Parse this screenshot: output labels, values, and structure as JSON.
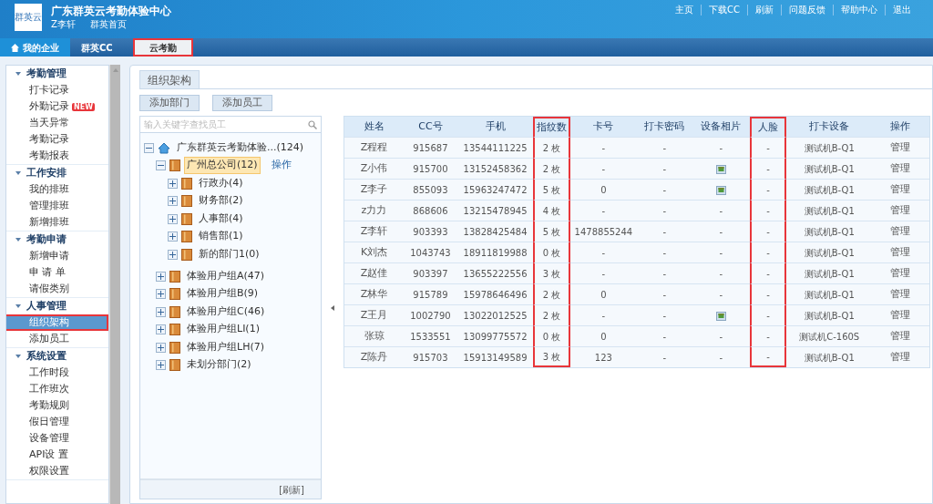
{
  "header": {
    "logo_text": "群英云",
    "title": "广东群英云考勤体验中心",
    "user": "Z李轩",
    "home_link": "群英首页",
    "links": [
      "主页",
      "下载CC",
      "刷新",
      "问题反馈",
      "帮助中心",
      "退出"
    ]
  },
  "nav_tabs": [
    {
      "label": "我的企业",
      "selected": true,
      "highlighted": false
    },
    {
      "label": "群英CC",
      "selected": false,
      "highlighted": false
    },
    {
      "label": "云考勤",
      "selected": false,
      "highlighted": true
    }
  ],
  "sidebar": [
    {
      "title": "考勤管理",
      "items": [
        {
          "label": "打卡记录",
          "selected": false,
          "highlighted": false
        },
        {
          "label": "外勤记录",
          "selected": false,
          "highlighted": false,
          "badge": "NEW"
        },
        {
          "label": "当天异常",
          "selected": false,
          "highlighted": false
        },
        {
          "label": "考勤记录",
          "selected": false,
          "highlighted": false
        },
        {
          "label": "考勤报表",
          "selected": false,
          "highlighted": false
        }
      ]
    },
    {
      "title": "工作安排",
      "items": [
        {
          "label": "我的排班",
          "selected": false,
          "highlighted": false
        },
        {
          "label": "管理排班",
          "selected": false,
          "highlighted": false
        },
        {
          "label": "新增排班",
          "selected": false,
          "highlighted": false
        }
      ]
    },
    {
      "title": "考勤申请",
      "items": [
        {
          "label": "新增申请",
          "selected": false,
          "highlighted": false
        },
        {
          "label": "申 请 单",
          "selected": false,
          "highlighted": false
        },
        {
          "label": "请假类别",
          "selected": false,
          "highlighted": false
        }
      ]
    },
    {
      "title": "人事管理",
      "items": [
        {
          "label": "组织架构",
          "selected": true,
          "highlighted": true
        },
        {
          "label": "添加员工",
          "selected": false,
          "highlighted": false
        }
      ]
    },
    {
      "title": "系统设置",
      "items": [
        {
          "label": "工作时段",
          "selected": false,
          "highlighted": false
        },
        {
          "label": "工作班次",
          "selected": false,
          "highlighted": false
        },
        {
          "label": "考勤规则",
          "selected": false,
          "highlighted": false
        },
        {
          "label": "假日管理",
          "selected": false,
          "highlighted": false
        },
        {
          "label": "设备管理",
          "selected": false,
          "highlighted": false
        },
        {
          "label": "API设 置",
          "selected": false,
          "highlighted": false
        },
        {
          "label": "权限设置",
          "selected": false,
          "highlighted": false
        }
      ]
    }
  ],
  "panel_tab": "组织架构",
  "buttons": [
    "添加部门",
    "添加员工"
  ],
  "search": {
    "placeholder": "输入关键字查找员工"
  },
  "tree": [
    {
      "label": "广东群英云考勤体验...(124)",
      "kind": "home",
      "expanded": true,
      "selected": false,
      "children": [
        {
          "label": "广州总公司(12)",
          "kind": "folder",
          "expanded": true,
          "selected": true,
          "action": "操作",
          "children": [
            {
              "label": "行政办(4)",
              "kind": "folder",
              "expanded": false,
              "selected": false
            },
            {
              "label": "财务部(2)",
              "kind": "folder",
              "expanded": false,
              "selected": false
            },
            {
              "label": "人事部(4)",
              "kind": "folder",
              "expanded": false,
              "selected": false
            },
            {
              "label": "销售部(1)",
              "kind": "folder",
              "expanded": false,
              "selected": false
            },
            {
              "label": "新的部门1(0)",
              "kind": "folder",
              "expanded": false,
              "selected": false
            }
          ]
        },
        {
          "label": "体验用户组A(47)",
          "kind": "folder",
          "expanded": false,
          "selected": false
        },
        {
          "label": "体验用户组B(9)",
          "kind": "folder",
          "expanded": false,
          "selected": false
        },
        {
          "label": "体验用户组C(46)",
          "kind": "folder",
          "expanded": false,
          "selected": false
        },
        {
          "label": "体验用户组LI(1)",
          "kind": "folder",
          "expanded": false,
          "selected": false
        },
        {
          "label": "体验用户组LH(7)",
          "kind": "folder",
          "expanded": false,
          "selected": false
        },
        {
          "label": "未划分部门(2)",
          "kind": "folder",
          "expanded": false,
          "selected": false
        }
      ]
    }
  ],
  "tree_refresh": "[刷新]",
  "table": {
    "columns": [
      {
        "label": "姓名",
        "highlighted": false
      },
      {
        "label": "CC号",
        "highlighted": false
      },
      {
        "label": "手机",
        "highlighted": false
      },
      {
        "label": "指纹数",
        "highlighted": true
      },
      {
        "label": "卡号",
        "highlighted": false
      },
      {
        "label": "打卡密码",
        "highlighted": false
      },
      {
        "label": "设备相片",
        "highlighted": false
      },
      {
        "label": "人脸",
        "highlighted": true
      },
      {
        "label": "打卡设备",
        "highlighted": false
      },
      {
        "label": "操作",
        "highlighted": false
      }
    ],
    "rows": [
      [
        "Z程程",
        "915687",
        "13544111225",
        "2 枚",
        "-",
        "-",
        "-",
        "-",
        "测试机B-Q1",
        "管理"
      ],
      [
        "Z小伟",
        "915700",
        "13152458362",
        "2 枚",
        "-",
        "-",
        {
          "kind": "photo"
        },
        "-",
        "测试机B-Q1",
        "管理"
      ],
      [
        "Z李子",
        "855093",
        "15963247472",
        "5 枚",
        "0",
        "-",
        {
          "kind": "photo"
        },
        "-",
        "测试机B-Q1",
        "管理"
      ],
      [
        "z力力",
        "868606",
        "13215478945",
        "4 枚",
        "-",
        "-",
        "-",
        "-",
        "测试机B-Q1",
        "管理"
      ],
      [
        "Z李轩",
        "903393",
        "13828425484",
        "5 枚",
        "1478855244",
        "-",
        "-",
        "-",
        "测试机B-Q1",
        "管理"
      ],
      [
        "K刘杰",
        "1043743",
        "18911819988",
        "0 枚",
        "-",
        "-",
        "-",
        "-",
        "测试机B-Q1",
        "管理"
      ],
      [
        "Z赵佳",
        "903397",
        "13655222556",
        "3 枚",
        "-",
        "-",
        "-",
        "-",
        "测试机B-Q1",
        "管理"
      ],
      [
        "Z林华",
        "915789",
        "15978646496",
        "2 枚",
        "0",
        "-",
        "-",
        "-",
        "测试机B-Q1",
        "管理"
      ],
      [
        "Z王月",
        "1002790",
        "13022012525",
        "2 枚",
        "-",
        "-",
        {
          "kind": "photo"
        },
        "-",
        "测试机B-Q1",
        "管理"
      ],
      [
        "张琼",
        "1533551",
        "13099775572",
        "0 枚",
        "0",
        "-",
        "-",
        "-",
        "测试机C-160S",
        "管理"
      ],
      [
        "Z陈丹",
        "915703",
        "15913149589",
        "3 枚",
        "123",
        "-",
        "-",
        "-",
        "测试机B-Q1",
        "管理"
      ]
    ]
  }
}
